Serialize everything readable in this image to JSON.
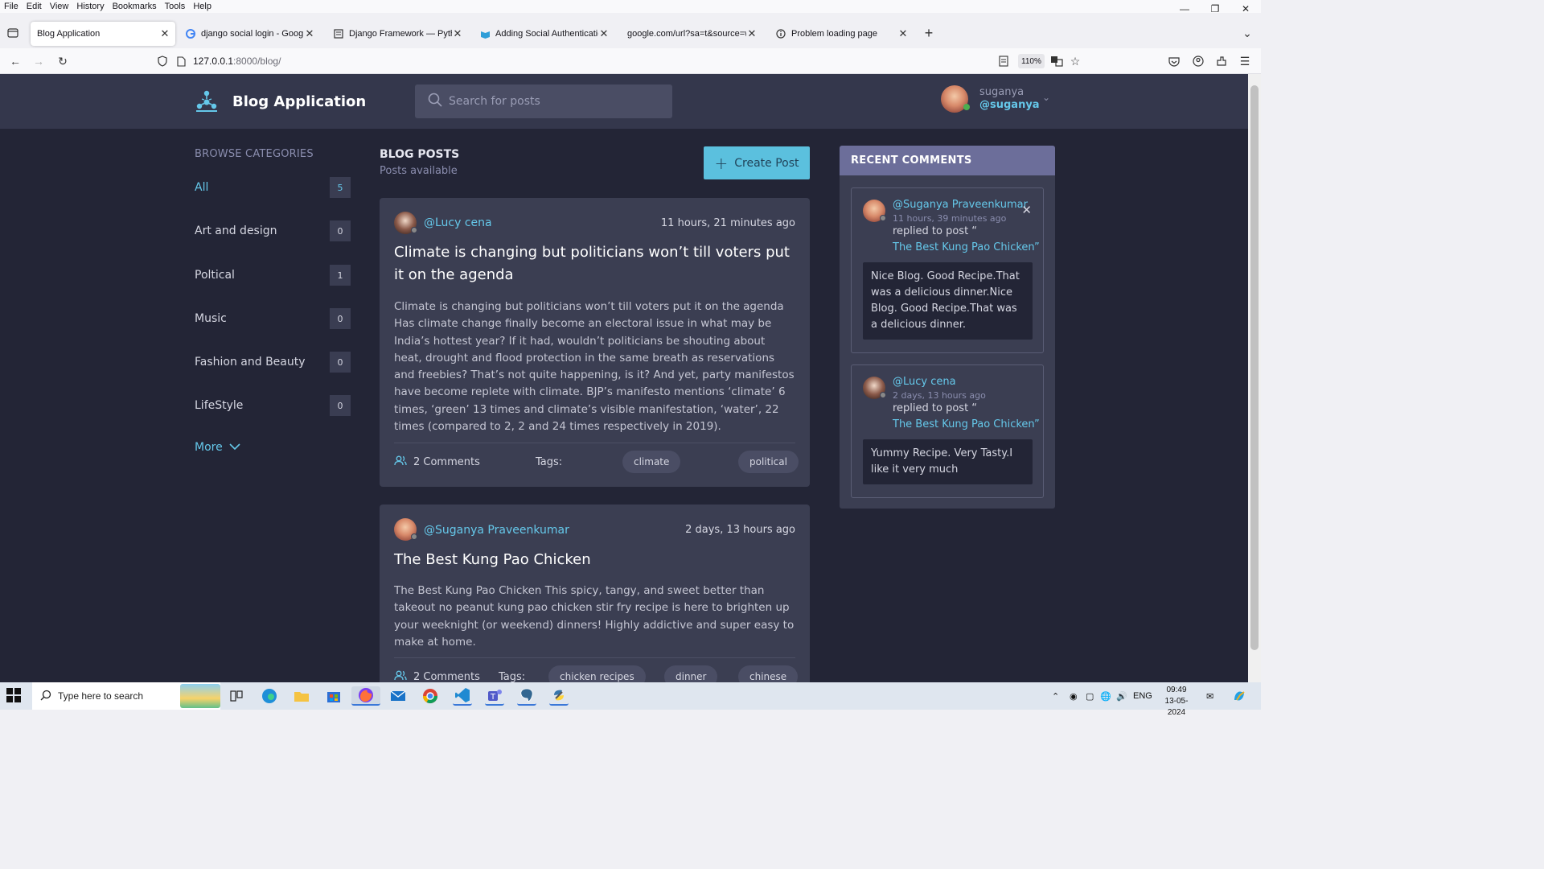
{
  "menubar": {
    "items": [
      "File",
      "Edit",
      "View",
      "History",
      "Bookmarks",
      "Tools",
      "Help"
    ]
  },
  "tabs": [
    {
      "title": "Blog Application",
      "icon": "none"
    },
    {
      "title": "django social login - Google Se",
      "icon": "google-icon"
    },
    {
      "title": "Django Framework — Python S",
      "icon": "page-icon"
    },
    {
      "title": "Adding Social Authentication to",
      "icon": "book-icon"
    },
    {
      "title": "google.com/url?sa=t&source=web",
      "icon": "none"
    },
    {
      "title": "Problem loading page",
      "icon": "info-icon"
    }
  ],
  "navbar": {
    "url_host": "127.0.0.1",
    "url_rest": ":8000/blog/",
    "zoom": "110%"
  },
  "header": {
    "brand": "Blog Application",
    "search_placeholder": "Search for posts",
    "user_name": "suganya",
    "user_handle": "@suganya"
  },
  "sidebar": {
    "heading": "BROWSE CATEGORIES",
    "categories": [
      {
        "label": "All",
        "count": "5"
      },
      {
        "label": "Art and design",
        "count": "0"
      },
      {
        "label": "Poltical",
        "count": "1"
      },
      {
        "label": "Music",
        "count": "0"
      },
      {
        "label": "Fashion and Beauty",
        "count": "0"
      },
      {
        "label": "LifeStyle",
        "count": "0"
      }
    ],
    "more": "More"
  },
  "main": {
    "title": "BLOG POSTS",
    "subtitle": "Posts available",
    "create_button": "Create Post",
    "tags_label": "Tags:",
    "posts": [
      {
        "author": "@Lucy cena",
        "time": "11 hours, 21 minutes ago",
        "title": "Climate is changing but politicians won’t till voters put it on the agenda",
        "body": "Climate is changing but politicians won’t till voters put it on the agenda Has climate change finally become an electoral issue in what may be India’s hottest year? If it had, wouldn’t politicians be shouting about heat, drought and flood protection in the same breath as reservations and freebies? That’s not quite happening, is it? And yet, party manifestos have become replete with climate. BJP’s manifesto mentions ‘climate’ 6 times, ‘green’ 13 times and climate’s visible manifestation, ‘water’, 22 times (compared to 2, 2 and 24 times respectively in 2019).",
        "comments": "2 Comments",
        "tags": [
          "climate",
          "political"
        ]
      },
      {
        "author": "@Suganya Praveenkumar",
        "time": "2 days, 13 hours ago",
        "title": "The Best Kung Pao Chicken",
        "body": "The Best Kung Pao Chicken This spicy, tangy, and sweet better than takeout no peanut kung pao chicken stir fry recipe is here to brighten up your weeknight (or weekend) dinners! Highly addictive and super easy to make at home.",
        "comments": "2 Comments",
        "tags": [
          "chicken recipes",
          "dinner",
          "chinese"
        ]
      }
    ]
  },
  "recent_comments": {
    "heading": "RECENT COMMENTS",
    "items": [
      {
        "name": "@Suganya Praveenkumar",
        "time": "11 hours, 39 minutes ago",
        "replied": "replied to post “",
        "post": "The Best Kung Pao Chicken”",
        "text": "Nice Blog. Good Recipe.That was a delicious dinner.Nice Blog. Good Recipe.That was a delicious dinner."
      },
      {
        "name": "@Lucy cena",
        "time": "2 days, 13 hours ago",
        "replied": "replied to post “",
        "post": "The Best Kung Pao Chicken”",
        "text": "Yummy Recipe. Very Tasty.I like it very much"
      }
    ]
  },
  "taskbar": {
    "search_placeholder": "Type here to search",
    "lang": "ENG",
    "time": "09:49",
    "date": "13-05-2024"
  }
}
